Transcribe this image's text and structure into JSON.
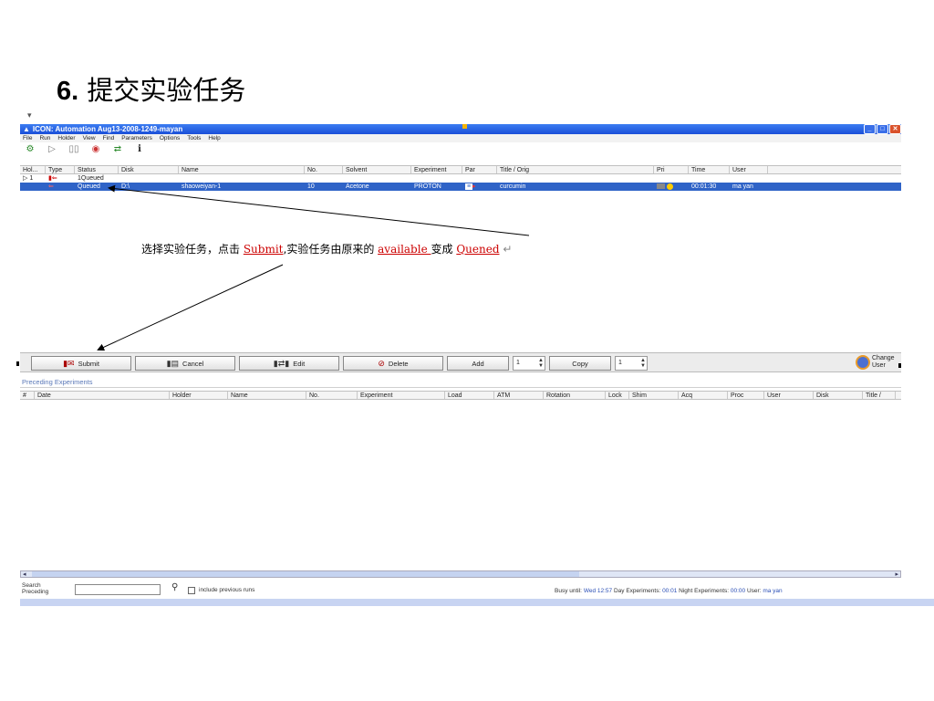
{
  "slide": {
    "number": "6.",
    "title": "提交实验任务",
    "tick": "▾"
  },
  "window": {
    "title": "ICON: Automation Aug13-2008-1249-mayan",
    "menu": [
      "File",
      "Run",
      "Holder",
      "View",
      "Find",
      "Parameters",
      "Options",
      "Tools",
      "Help"
    ],
    "toolbar_icons": [
      "gear-icon",
      "play-icon",
      "pause-icon",
      "stop-icon",
      "swap-icon",
      "info-icon"
    ],
    "queue_table": {
      "headers": [
        "Hol...",
        "Type",
        "Status",
        "Disk",
        "Name",
        "No.",
        "Solvent",
        "Experiment",
        "Par",
        "Title / Orig",
        "Pri",
        "Time",
        "User"
      ],
      "group_row": {
        "expander": "▷ 1",
        "status": "1Queued"
      },
      "rows": [
        {
          "status": "Queued",
          "disk": "D:\\",
          "name": "shaoweiyan-1",
          "no": "10",
          "solvent": "Acetone",
          "experiment": "PROTON",
          "title": "curcumin",
          "time": "00:01:30",
          "user": "ma yan"
        }
      ]
    },
    "buttons": {
      "submit": "Submit",
      "cancel": "Cancel",
      "edit": "Edit",
      "delete": "Delete",
      "add": "Add",
      "add_count": "1",
      "copy": "Copy",
      "copy_count": "1",
      "change_user": "Change User"
    },
    "preceding": {
      "label": "Preceding Experiments",
      "headers": [
        "#",
        "Date",
        "Holder",
        "Name",
        "No.",
        "Experiment",
        "Load",
        "ATM",
        "Rotation",
        "Lock",
        "Shim",
        "Acq",
        "Proc",
        "User",
        "Disk",
        "Title /"
      ]
    },
    "status": {
      "search_label": "Search Preceding",
      "include_label": "include previous runs",
      "busy_label": "Busy until:",
      "busy_value": "Wed 12:57",
      "day_label": "Day Experiments:",
      "day_value": "00:01",
      "night_label": "Night Experiments:",
      "night_value": "00:00",
      "user_label": "User:",
      "user_value": "ma yan"
    }
  },
  "annotation": {
    "p1": "选择实验任务，点击 ",
    "submit": "Submit",
    "p2": ",实验任务由原来的 ",
    "available": "available ",
    "p3": "变成 ",
    "queued": "Quened",
    "p4": " ↵"
  }
}
